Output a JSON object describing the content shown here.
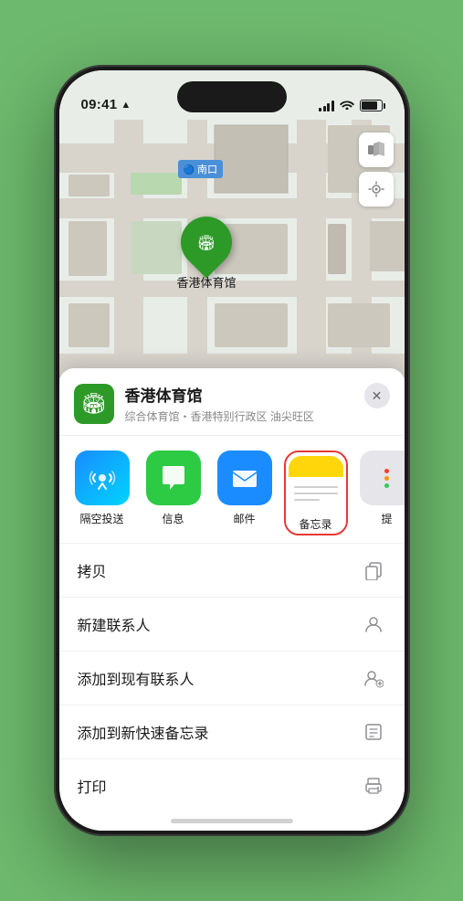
{
  "status_bar": {
    "time": "09:41",
    "location_arrow": "▶"
  },
  "map": {
    "label_nank": "南口",
    "controls": {
      "map_type_icon": "🗺",
      "location_icon": "➤"
    },
    "pin_label": "香港体育馆",
    "pin_emoji": "🏟"
  },
  "bottom_sheet": {
    "venue_icon": "🏟",
    "venue_name": "香港体育馆",
    "venue_desc": "综合体育馆・香港特别行政区 油尖旺区",
    "close_icon": "✕",
    "share_items": [
      {
        "id": "airdrop",
        "label": "隔空投送",
        "icon_class": "icon-airdrop",
        "symbol": "📡"
      },
      {
        "id": "message",
        "label": "信息",
        "icon_class": "icon-message",
        "symbol": "💬"
      },
      {
        "id": "mail",
        "label": "邮件",
        "icon_class": "icon-mail",
        "symbol": "✉"
      },
      {
        "id": "notes",
        "label": "备忘录",
        "icon_class": "icon-notes",
        "symbol": ""
      },
      {
        "id": "more",
        "label": "提",
        "icon_class": "icon-more-dots",
        "symbol": ""
      }
    ],
    "actions": [
      {
        "id": "copy",
        "label": "拷贝",
        "icon": "⧉"
      },
      {
        "id": "new-contact",
        "label": "新建联系人",
        "icon": "👤"
      },
      {
        "id": "add-existing",
        "label": "添加到现有联系人",
        "icon": "👤+"
      },
      {
        "id": "add-notes",
        "label": "添加到新快速备忘录",
        "icon": "📋"
      },
      {
        "id": "print",
        "label": "打印",
        "icon": "🖨"
      }
    ]
  }
}
